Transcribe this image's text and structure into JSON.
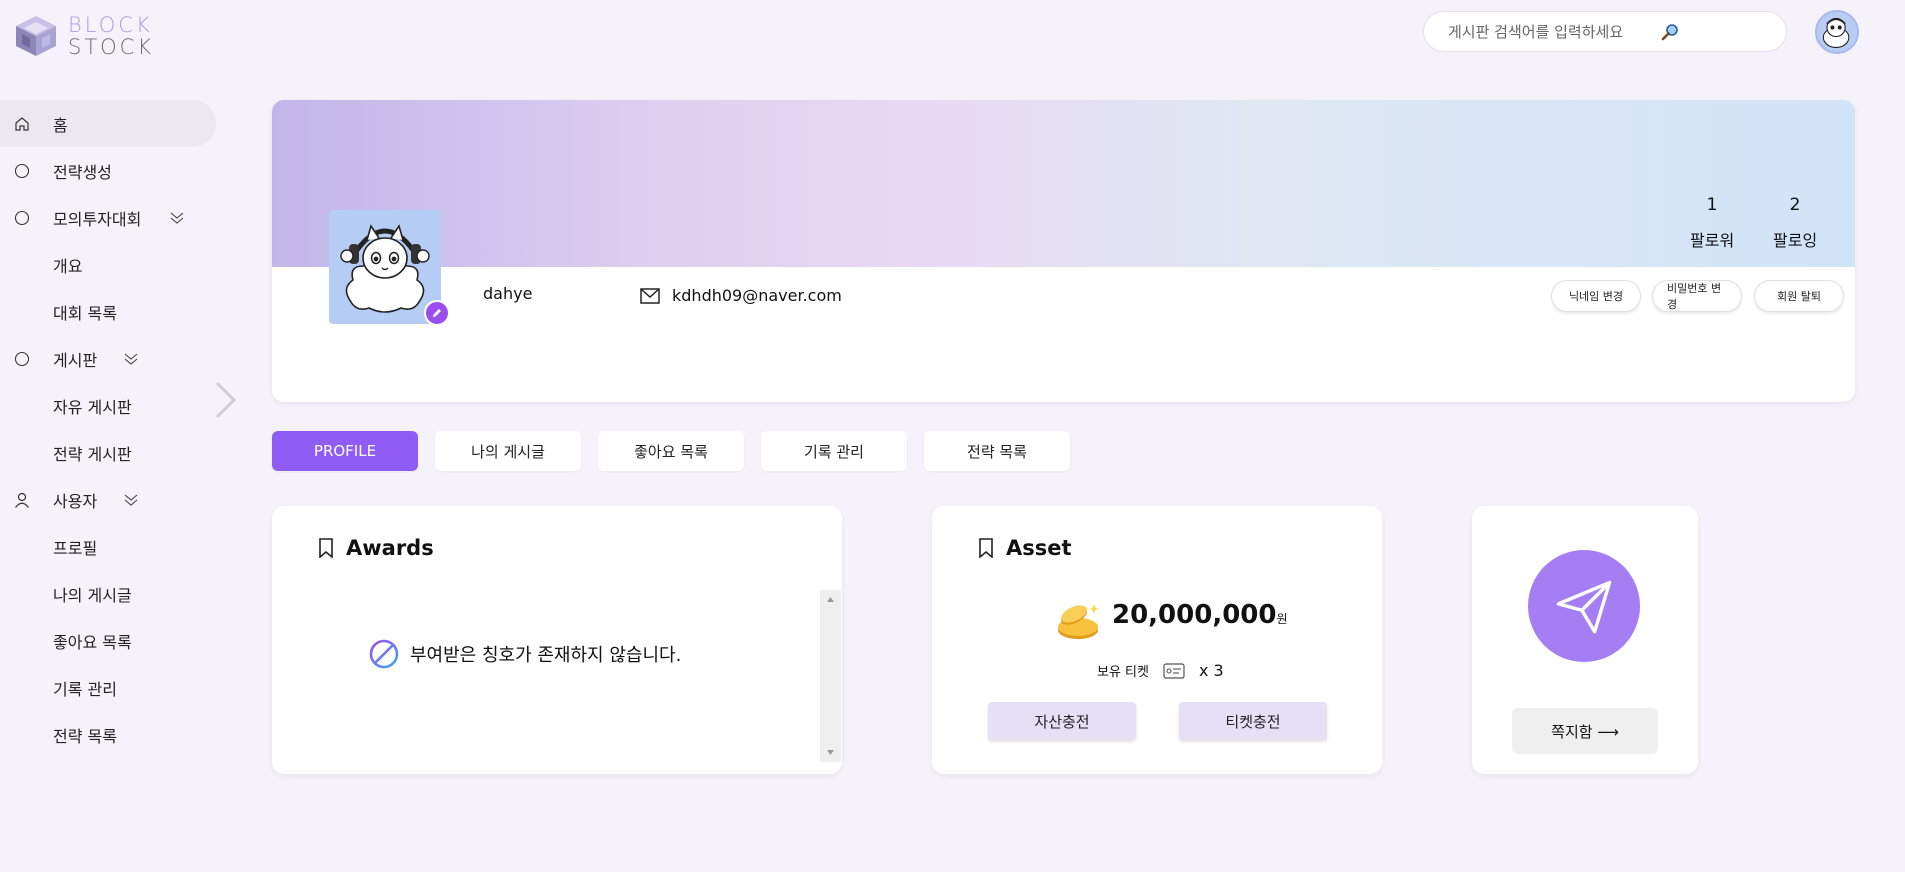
{
  "logo": {
    "line1": "BLOCK",
    "line2": "STOCK"
  },
  "search": {
    "placeholder": "게시판 검색어를 입력하세요"
  },
  "sidebar": {
    "home": "홈",
    "strategy_create": "전략생성",
    "mock_contest": "모의투자대회",
    "mock_sub": [
      "개요",
      "대회 목록"
    ],
    "board": "게시판",
    "board_sub": [
      "자유 게시판",
      "전략 게시판"
    ],
    "user": "사용자",
    "user_sub": [
      "프로필",
      "나의 게시글",
      "좋아요 목록",
      "기록 관리",
      "전략 목록"
    ]
  },
  "profile": {
    "followers_count": "1",
    "followers_label": "팔로워",
    "following_count": "2",
    "following_label": "팔로잉",
    "nickname": "dahye",
    "email": "kdhdh09@naver.com",
    "buttons": {
      "change_nickname": "닉네임 변경",
      "change_password": "비밀번호 변경",
      "withdraw": "회원 탈퇴"
    }
  },
  "tabs": [
    "PROFILE",
    "나의 게시글",
    "좋아요 목록",
    "기록 관리",
    "전략 목록"
  ],
  "awards": {
    "title": "Awards",
    "empty_message": "부여받은 칭호가 존재하지 않습니다."
  },
  "asset": {
    "title": "Asset",
    "amount": "20,000,000",
    "unit": "원",
    "ticket_label": "보유 티켓",
    "ticket_count": "x 3",
    "charge_asset": "자산충전",
    "charge_ticket": "티켓충전"
  },
  "message": {
    "button": "쪽지함 ⟶"
  },
  "colors": {
    "accent": "#8f5df5",
    "plane": "#a57ef4",
    "edit": "#9b4ef0"
  }
}
